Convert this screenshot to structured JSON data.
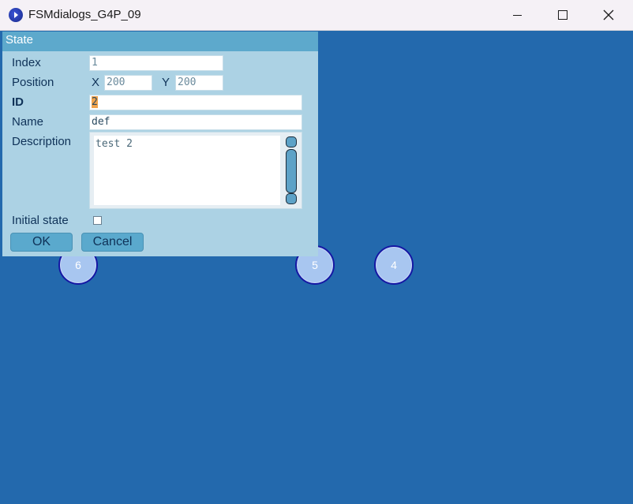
{
  "window": {
    "title": "FSMdialogs_G4P_09"
  },
  "nodes": [
    {
      "label": "6"
    },
    {
      "label": "5"
    },
    {
      "label": "4"
    }
  ],
  "dialog": {
    "title": "State",
    "index": {
      "label": "Index",
      "value": "1"
    },
    "position": {
      "label": "Position",
      "x_label": "X",
      "x_value": "200",
      "y_label": "Y",
      "y_value": "200"
    },
    "id": {
      "label": "ID",
      "value": "2"
    },
    "name": {
      "label": "Name",
      "value": "def"
    },
    "description": {
      "label": "Description",
      "value": "test 2"
    },
    "initial_state": {
      "label": "Initial state",
      "checked": false
    },
    "ok_label": "OK",
    "cancel_label": "Cancel"
  },
  "colors": {
    "background": "#2369ad",
    "dialog_bg": "#acd2e4",
    "dialog_title_bg": "#5da9cc",
    "node_fill": "#a8c6f0",
    "node_border": "#1518a4",
    "selection": "#f0a34c"
  }
}
